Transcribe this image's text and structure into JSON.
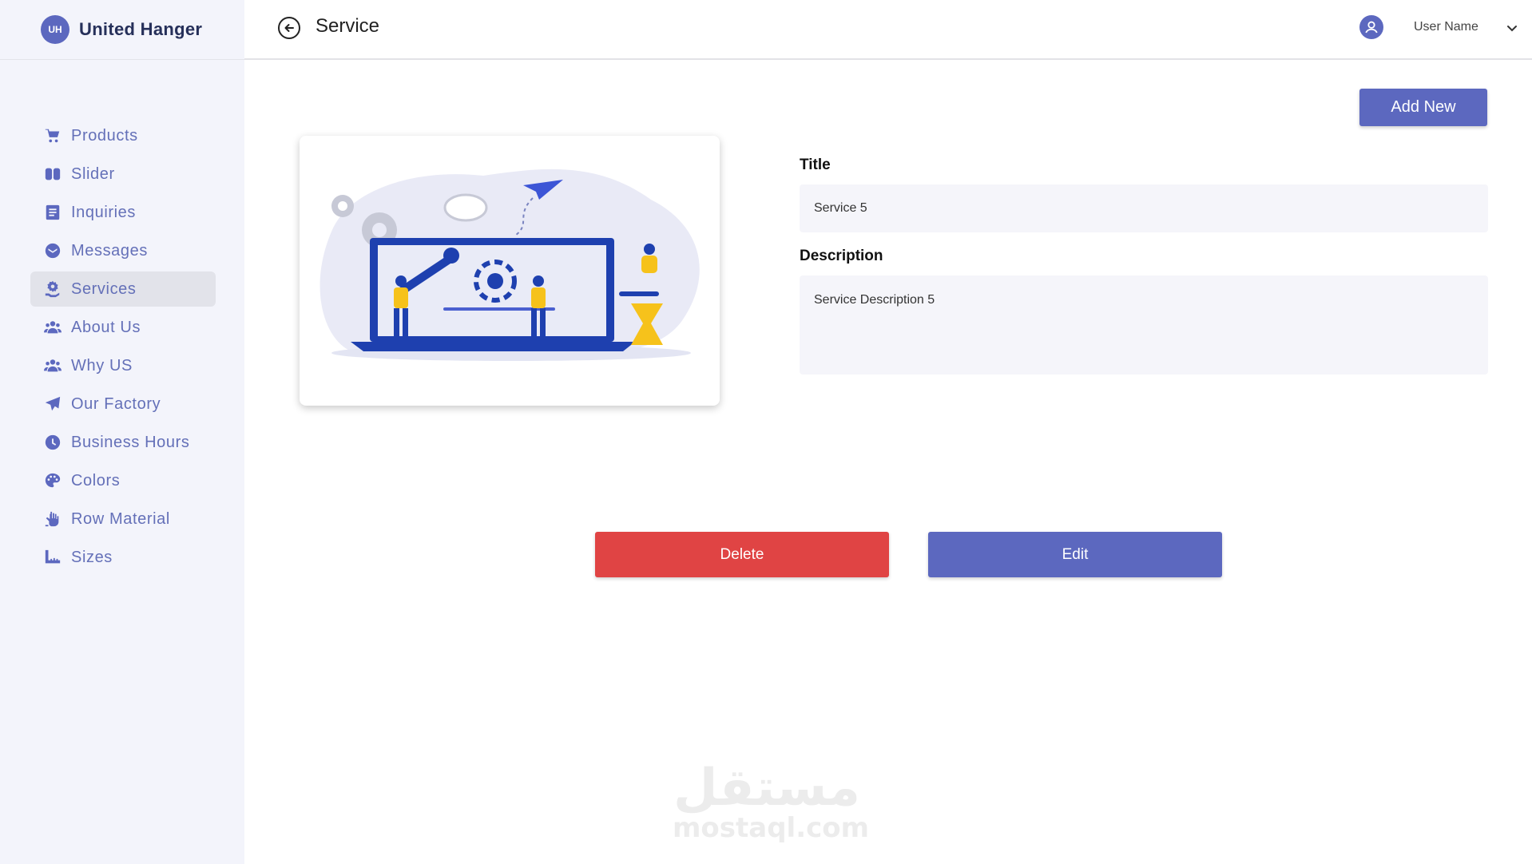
{
  "brand": {
    "logo_text": "UH",
    "name": "United Hanger"
  },
  "sidebar": {
    "items": [
      {
        "label": "Products",
        "icon": "cart-icon"
      },
      {
        "label": "Slider",
        "icon": "slider-icon"
      },
      {
        "label": "Inquiries",
        "icon": "document-icon"
      },
      {
        "label": "Messages",
        "icon": "mail-icon"
      },
      {
        "label": "Services",
        "icon": "service-gear-hand-icon",
        "active": true
      },
      {
        "label": "About Us",
        "icon": "users-icon"
      },
      {
        "label": "Why US",
        "icon": "users-icon"
      },
      {
        "label": "Our Factory",
        "icon": "paper-plane-icon"
      },
      {
        "label": "Business Hours",
        "icon": "clock-icon"
      },
      {
        "label": "Colors",
        "icon": "palette-icon"
      },
      {
        "label": "Row Material",
        "icon": "hand-icon"
      },
      {
        "label": "Sizes",
        "icon": "ruler-icon"
      }
    ]
  },
  "header": {
    "title": "Service",
    "user_name": "User Name"
  },
  "main": {
    "add_new_label": "Add New",
    "title_label": "Title",
    "title_value": "Service 5",
    "description_label": "Description",
    "description_value": "Service Description 5",
    "delete_label": "Delete",
    "edit_label": "Edit"
  },
  "watermark": {
    "arabic": "مستقل",
    "latin": "mostaql.com"
  },
  "colors": {
    "accent": "#5c68bf",
    "danger": "#e04444",
    "sidebar_bg": "#f3f4fb",
    "field_bg": "#f5f5fa"
  }
}
